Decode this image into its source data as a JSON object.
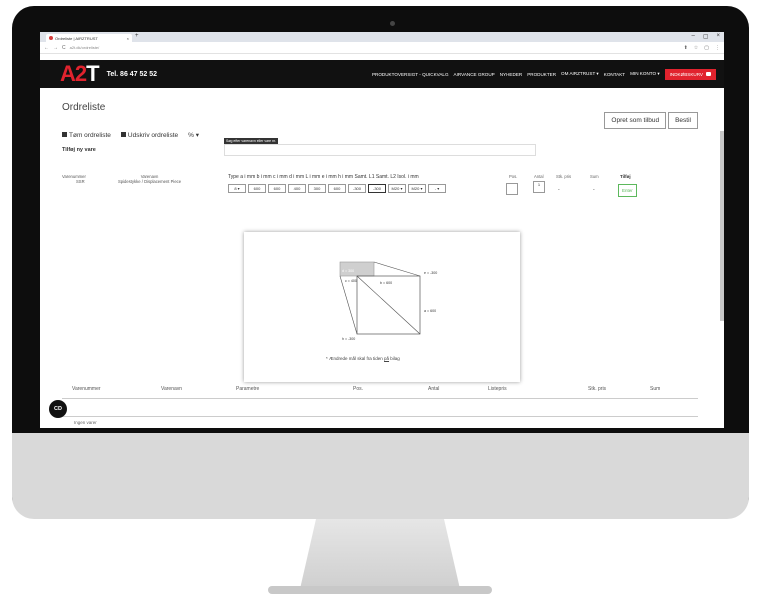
{
  "browser": {
    "tab_title": "Ordreliste | AIRZTRUST",
    "tab_close": "×",
    "new_tab": "+",
    "url": "a2t.dk/ordreliste/",
    "window_controls": [
      "–",
      "▢",
      "×"
    ],
    "nav_buttons": [
      "←",
      "→",
      "C"
    ],
    "addr_icons": [
      "⬆",
      "☆",
      "▢",
      "⋮"
    ]
  },
  "site_nav": {
    "logo_a2": "A2",
    "logo_t": "T",
    "phone": "Tel. 86 47 52 52",
    "items": [
      "PRODUKTOVERSIGT - QUICKVALG",
      "AIRVANCE GROUP",
      "NYHEDER",
      "PRODUKTER",
      "OM AIRZTRUST ▾",
      "KONTAKT",
      "MIN KONTO ▾"
    ],
    "cart_label": "INDKØBSKURV",
    "colors": {
      "accent": "#e1232e",
      "bar": "#111111"
    }
  },
  "page": {
    "title": "Ordreliste",
    "toolbar": {
      "empty": "Tøm ordreliste",
      "print": "Udskriv ordreliste",
      "percent": "% ▾"
    },
    "buttons": {
      "offer": "Opret som tilbud",
      "order": "Bestil"
    },
    "add_product_title": "Tilføj ny vare",
    "search_label": "Søg efter varenavn eller vare nr.",
    "product": {
      "number_head": "Varenummer",
      "number": "SSR",
      "name_head": "Varenavn",
      "name": "Spidestykke / Displacement Piece"
    },
    "params_header": "Type  a i mm  b i mm  c i mm  d i mm  L i mm  e i mm  h i mm  Samt. L1  Samt. L2  Isol. i mm",
    "param_values": [
      "8 ▾",
      "600",
      "600",
      "400",
      "300",
      "600",
      "-300",
      "-300",
      "M20 ▾",
      "M20 ▾",
      "- ▾"
    ],
    "pos_head": "Pos.",
    "antal_head": "Antal",
    "antal_value": "1",
    "stk_pris_head": "Stk. pris",
    "stk_pris_value": "-",
    "sum_head": "Sum",
    "sum_value": "-",
    "tilfoj_head": "Tilføj",
    "tilfoj_button": "Enter",
    "diagram_labels": {
      "d": "d = 300",
      "c": "c = 400",
      "b": "b = 600",
      "e": "e = -300",
      "a": "a = 600",
      "h": "h = -300"
    },
    "popup_note_prefix": "* Ændrede mål skal fra tiden ",
    "popup_note_link": "på",
    "popup_note_suffix": " bilag",
    "table_headers": [
      "Varenummer",
      "Varenavn",
      "Parametre",
      "Pos.",
      "Antal",
      "Listepris",
      "Stk. pris",
      "Sum"
    ],
    "empty_text": "Ingen varer",
    "cd_badge": "CD"
  }
}
